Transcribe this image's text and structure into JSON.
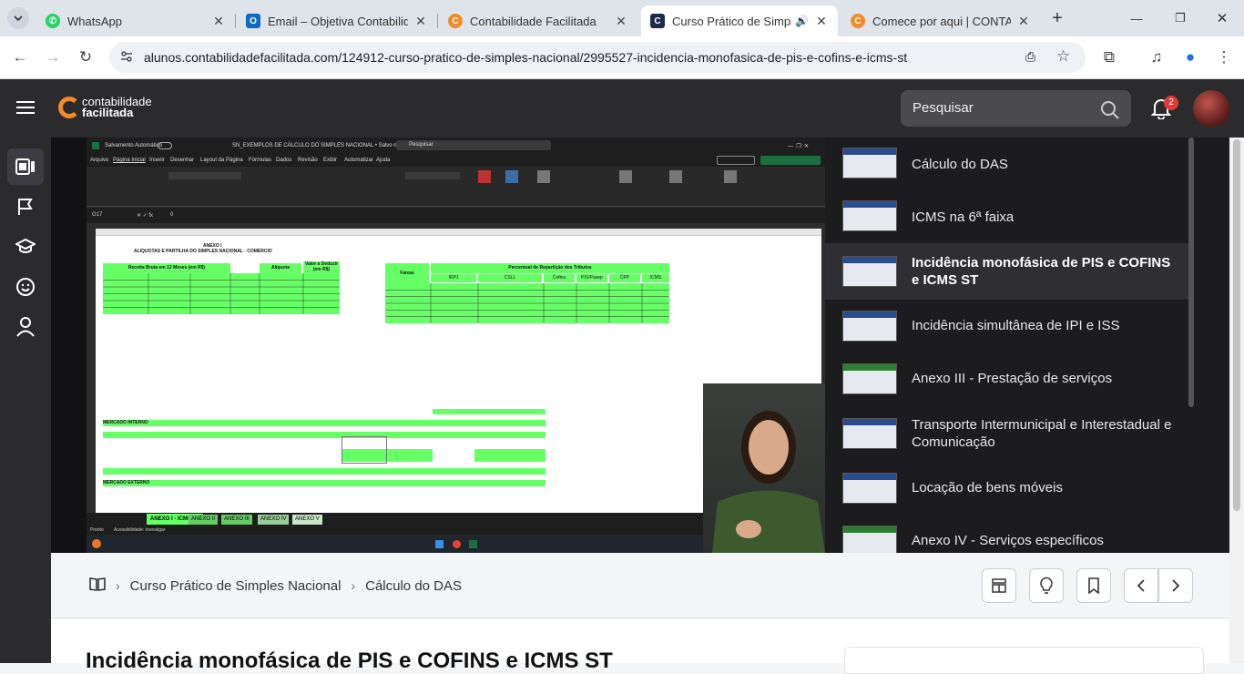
{
  "browser": {
    "tabs": [
      {
        "title": "WhatsApp",
        "icon": "whatsapp-icon",
        "color": "#25d366"
      },
      {
        "title": "Email – Objetiva Contabilidade",
        "icon": "outlook-icon",
        "color": "#0f6cbd"
      },
      {
        "title": "Contabilidade Facilitada",
        "icon": "cf-logo-icon",
        "color": "#f28c28"
      },
      {
        "title": "Curso Prático de Simples Nacional",
        "icon": "cf-dark-icon",
        "color": "#1d2a4a"
      },
      {
        "title": "Comece por aqui | CONTABILIDADE",
        "icon": "cf-logo-icon",
        "color": "#f28c28"
      }
    ],
    "url": "alunos.contabilidadefacilitada.com/124912-curso-pratico-de-simples-nacional/2995527-incidencia-monofasica-de-pis-e-cofins-e-icms-st"
  },
  "app": {
    "logo_line1": "contabilidade",
    "logo_line2": "facilitada",
    "search_placeholder": "Pesquisar",
    "notif_count": "2"
  },
  "video": {
    "excel": {
      "title": "SN_EXEMPLOS DE CÁLCULO DO SIMPLES NACIONAL • Salvo neste PC",
      "autosave": "Salvamento Automático",
      "search": "Pesquisar",
      "menu": [
        "Arquivo",
        "Página Inicial",
        "Inserir",
        "Desenhar",
        "Layout da Página",
        "Fórmulas",
        "Dados",
        "Revisão",
        "Exibir",
        "Automatizar",
        "Ajuda"
      ],
      "cell_ref": "G17",
      "formula": "0",
      "sheet_title": "ANEXO I",
      "sheet_subtitle": "ALÍQUOTAS E PARTILHA DO SIMPLES NACIONAL - COMÉRCIO",
      "header_rb": "Receita Bruta em 12 Meses (em R$)",
      "header_aliq": "Alíquota",
      "header_ded": "Valor a Deduzir (em R$)",
      "header_faixas": "Faixas",
      "header_partilha": "Percentual de Repartição dos Tributos",
      "tribute_cols": [
        "IRPJ",
        "CSLL",
        "Cofins",
        "PIS/Pasep",
        "CPP",
        "ICMS"
      ],
      "faixas": [
        "1ª Faixa",
        "2ª Faixa",
        "3ª Faixa",
        "4ª Faixa",
        "5ª Faixa",
        "6ª Faixa"
      ],
      "section_interno": "MERCADO INTERNO",
      "section_externo": "MERCADO EXTERNO",
      "tabs": [
        "ANEXO I - ICMS ST",
        "ANEXO II",
        "ANEXO III",
        "ANEXO IV",
        "ANEXO V"
      ],
      "status": "Pronto",
      "accessibility": "Acessibilidade: Investigar"
    }
  },
  "playlist": [
    {
      "title": "Cálculo do DAS",
      "active": false
    },
    {
      "title": "ICMS na 6ª faixa",
      "active": false
    },
    {
      "title": "Incidência monofásica de PIS e COFINS e ICMS ST",
      "active": true
    },
    {
      "title": "Incidência simultânea de IPI e ISS",
      "active": false
    },
    {
      "title": "Anexo III - Prestação de serviços",
      "active": false
    },
    {
      "title": "Transporte Intermunicipal e Interestadual e Comunicação",
      "active": false
    },
    {
      "title": "Locação de bens móveis",
      "active": false
    },
    {
      "title": "Anexo IV - Serviços específicos",
      "active": false
    }
  ],
  "breadcrumb": {
    "course": "Curso Prático de Simples Nacional",
    "lesson": "Cálculo do DAS"
  },
  "lesson": {
    "title": "Incidência monofásica de PIS e COFINS e ICMS ST"
  }
}
